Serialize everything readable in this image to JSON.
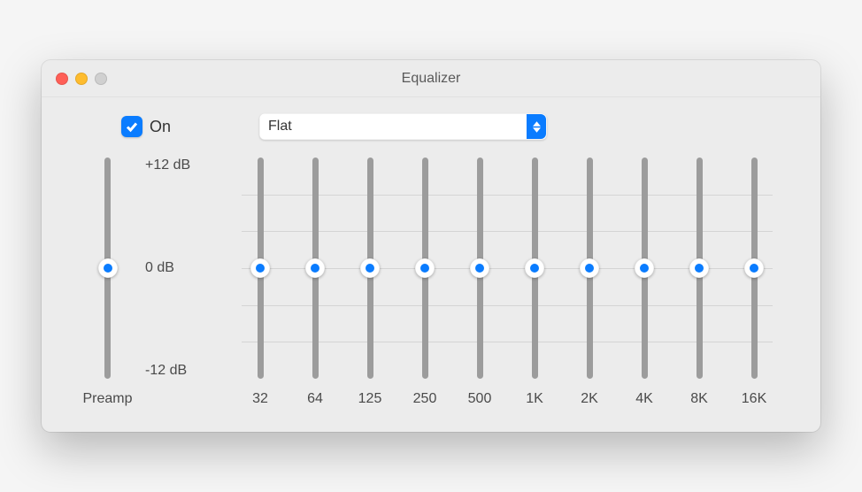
{
  "window": {
    "title": "Equalizer"
  },
  "controls": {
    "on_label": "On",
    "on_checked": true,
    "preset": "Flat"
  },
  "db_labels": {
    "top": "+12 dB",
    "mid": "0 dB",
    "bot": "-12 dB"
  },
  "preamp": {
    "label": "Preamp",
    "value_db": 0
  },
  "bands": [
    {
      "label": "32",
      "value_db": 0
    },
    {
      "label": "64",
      "value_db": 0
    },
    {
      "label": "125",
      "value_db": 0
    },
    {
      "label": "250",
      "value_db": 0
    },
    {
      "label": "500",
      "value_db": 0
    },
    {
      "label": "1K",
      "value_db": 0
    },
    {
      "label": "2K",
      "value_db": 0
    },
    {
      "label": "4K",
      "value_db": 0
    },
    {
      "label": "8K",
      "value_db": 0
    },
    {
      "label": "16K",
      "value_db": 0
    }
  ],
  "colors": {
    "accent": "#0a7cff",
    "window_bg": "#ececec",
    "track": "#9c9c9c"
  }
}
